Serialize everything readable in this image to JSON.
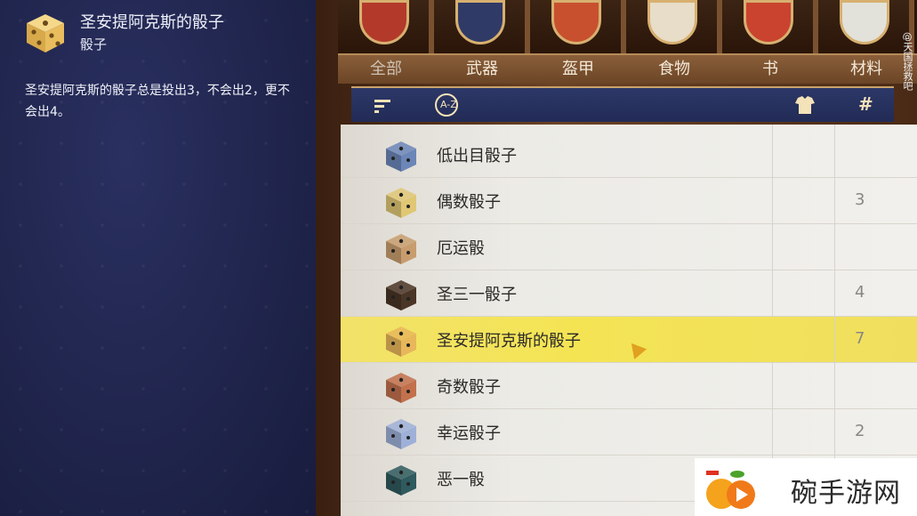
{
  "info": {
    "title": "圣安提阿克斯的骰子",
    "subtitle": "骰子",
    "description": "圣安提阿克斯的骰子总是投出3，不会出2，更不会出4。"
  },
  "tabs": [
    {
      "label": "全部"
    },
    {
      "label": "武器"
    },
    {
      "label": "盔甲"
    },
    {
      "label": "食物"
    },
    {
      "label": "书"
    },
    {
      "label": "材料"
    }
  ],
  "toolbar": {
    "sort_icon": "sort-icon",
    "alpha_icon": "A-Z",
    "armor_icon": "armor-icon",
    "count_icon": "#"
  },
  "items": [
    {
      "name": "低出目骰子",
      "count": "",
      "color": "#6c86b8"
    },
    {
      "name": "偶数骰子",
      "count": "3",
      "color": "#e0c774"
    },
    {
      "name": "厄运骰",
      "count": "",
      "color": "#c89d6e"
    },
    {
      "name": "圣三一骰子",
      "count": "4",
      "color": "#4a3526"
    },
    {
      "name": "圣安提阿克斯的骰子",
      "count": "7",
      "color": "#e8b75a"
    },
    {
      "name": "奇数骰子",
      "count": "",
      "color": "#c2714c"
    },
    {
      "name": "幸运骰子",
      "count": "2",
      "color": "#9fb0d8"
    },
    {
      "name": "恶一骰",
      "count": "",
      "color": "#2f5a5e"
    }
  ],
  "watermark": "@天国拯救吧",
  "logo": {
    "text": "碗手游网"
  },
  "colors": {
    "selected_row": "#f2e26a",
    "panel_bg": "#20254d",
    "accent_gold": "#c9a36a"
  }
}
